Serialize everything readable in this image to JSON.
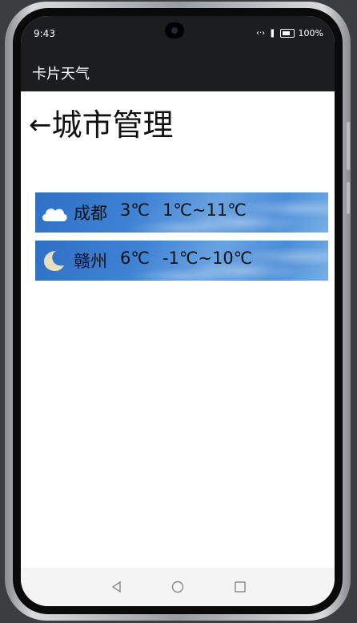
{
  "status_bar": {
    "time": "9:43",
    "battery_text": "100%",
    "icons": [
      "signal-arrows-icon",
      "alert-icon",
      "battery-icon"
    ]
  },
  "app_bar": {
    "title": "卡片天气"
  },
  "page": {
    "back_glyph": "←",
    "title": "城市管理"
  },
  "cities": [
    {
      "name": "成都",
      "temp": "3℃",
      "range": "1℃~11℃",
      "icon": "cloud-icon"
    },
    {
      "name": "赣州",
      "temp": "6℃",
      "range": "-1℃~10℃",
      "icon": "moon-icon"
    }
  ],
  "nav_bar": {
    "buttons": [
      "back-triangle-icon",
      "home-circle-icon",
      "recents-square-icon"
    ]
  },
  "colors": {
    "bar_dark": "#1b1d1e",
    "card_blue": "#3f82d4"
  }
}
